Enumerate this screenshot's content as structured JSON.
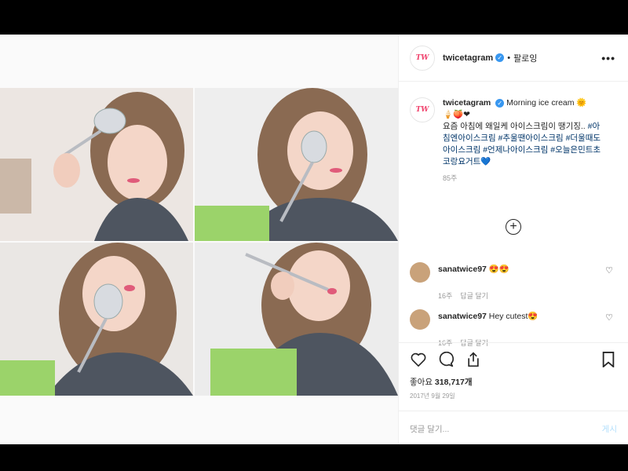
{
  "post": {
    "account": "twicetagram",
    "follow_label": "팔로잉",
    "more_label": "•••",
    "caption_main": "Morning ice cream",
    "caption_emoji_sun": "🌞",
    "caption_emoji_line": "🍦🍑❤",
    "caption_text": "요즘 아침에 왜일케 아이스크림이 땡기징..",
    "hashtags": "#아침엔아이스크림 #추울땐아이스크림 #더울때도아이스크림 #언제나아이스크림 #오늘은민트초코랑요거트",
    "caption_end_emoji": "💙",
    "caption_age": "85주",
    "comments": [
      {
        "user": "sanatwice97",
        "text": "😍😍",
        "age": "16주",
        "reply": "답글 달기"
      },
      {
        "user": "sanatwice97",
        "text": "Hey cutest😍",
        "age": "16주",
        "reply": "답글 달기"
      }
    ],
    "likes_label": "좋아요",
    "likes_count": "318,717개",
    "date": "2017년 9월 29일",
    "comment_placeholder": "댓글 달기...",
    "post_button": "게시",
    "colors": {
      "verified": "#3897f0",
      "logo": "#f0436d",
      "cup": "#9bd36a",
      "hoodie": "#4e5560",
      "hair": "#8a6a52"
    }
  }
}
